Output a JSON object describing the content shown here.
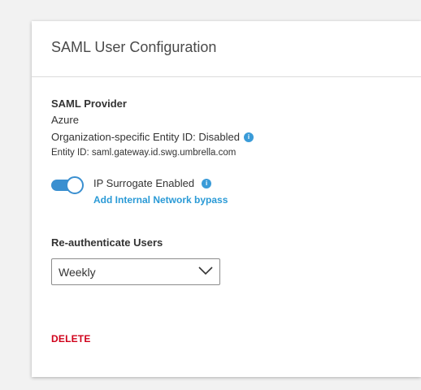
{
  "colors": {
    "accent_blue": "#3a8fd0",
    "link_blue": "#2a9ad6",
    "delete_red": "#d0021b",
    "page_background": "#f2f2f2",
    "card_background": "#ffffff"
  },
  "card": {
    "title": "SAML User Configuration"
  },
  "saml_provider": {
    "heading": "SAML Provider",
    "name": "Azure",
    "org_entity_id_label": "Organization-specific Entity ID: Disabled",
    "org_entity_id_info_icon": "info-icon",
    "entity_id_label": "Entity ID: saml.gateway.id.swg.umbrella.com"
  },
  "ip_surrogate": {
    "enabled": true,
    "label": "IP Surrogate Enabled",
    "info_icon": "info-icon",
    "bypass_link": "Add Internal Network bypass"
  },
  "reauthenticate": {
    "heading": "Re-authenticate Users",
    "selected_value": "Weekly",
    "chevron_icon": "chevron-down-icon"
  },
  "actions": {
    "delete_label": "DELETE"
  }
}
